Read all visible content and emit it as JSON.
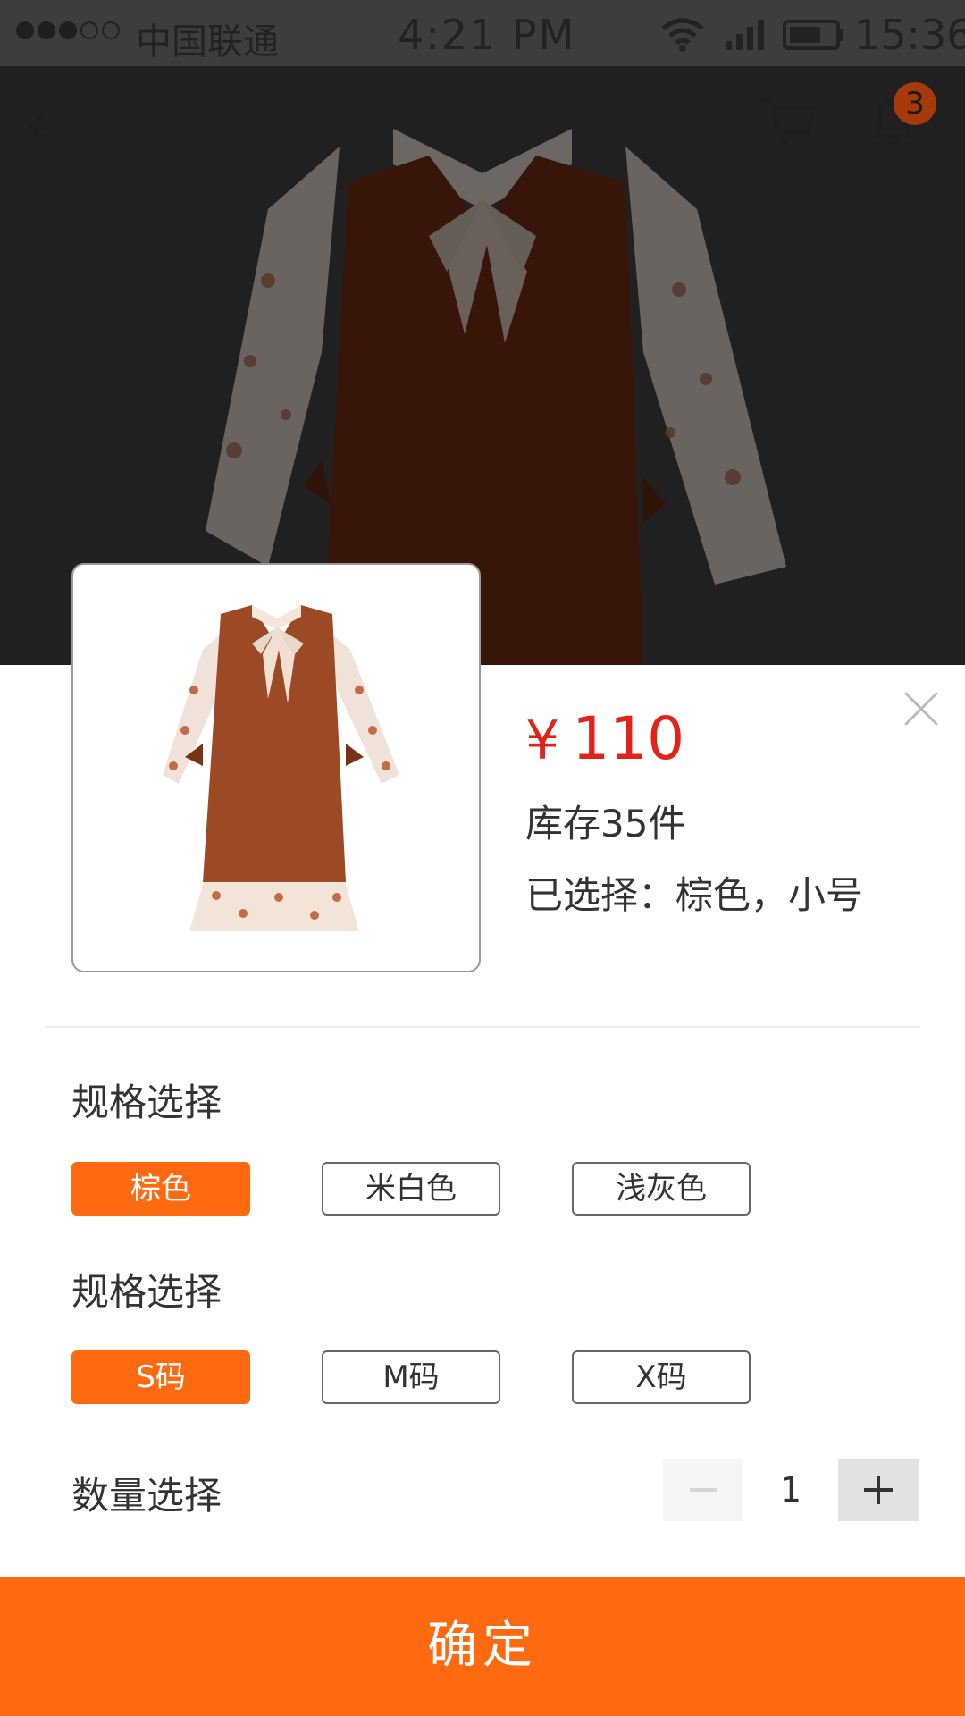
{
  "status_bar": {
    "carrier": "中国联通",
    "time": "4:21 PM",
    "battery_time": "15:36"
  },
  "nav": {
    "notification_count": "3",
    "icons": [
      "back-arrow-icon",
      "cart-icon",
      "bell-icon"
    ]
  },
  "product": {
    "currency": "¥",
    "price": "110",
    "stock": "库存35件",
    "selected_label": "已选择：",
    "selected_value": "棕色，小号"
  },
  "spec_groups": [
    {
      "title": "规格选择",
      "options": [
        "棕色",
        "米白色",
        "浅灰色"
      ],
      "active_index": 0
    },
    {
      "title": "规格选择",
      "options": [
        "S码",
        "M码",
        "X码"
      ],
      "active_index": 0
    }
  ],
  "quantity": {
    "label": "数量选择",
    "value": "1",
    "minus": "−",
    "plus": "+"
  },
  "confirm_label": "确定",
  "colors": {
    "accent": "#ff6a10",
    "price": "#e2231a",
    "badge": "#a63a0c"
  }
}
